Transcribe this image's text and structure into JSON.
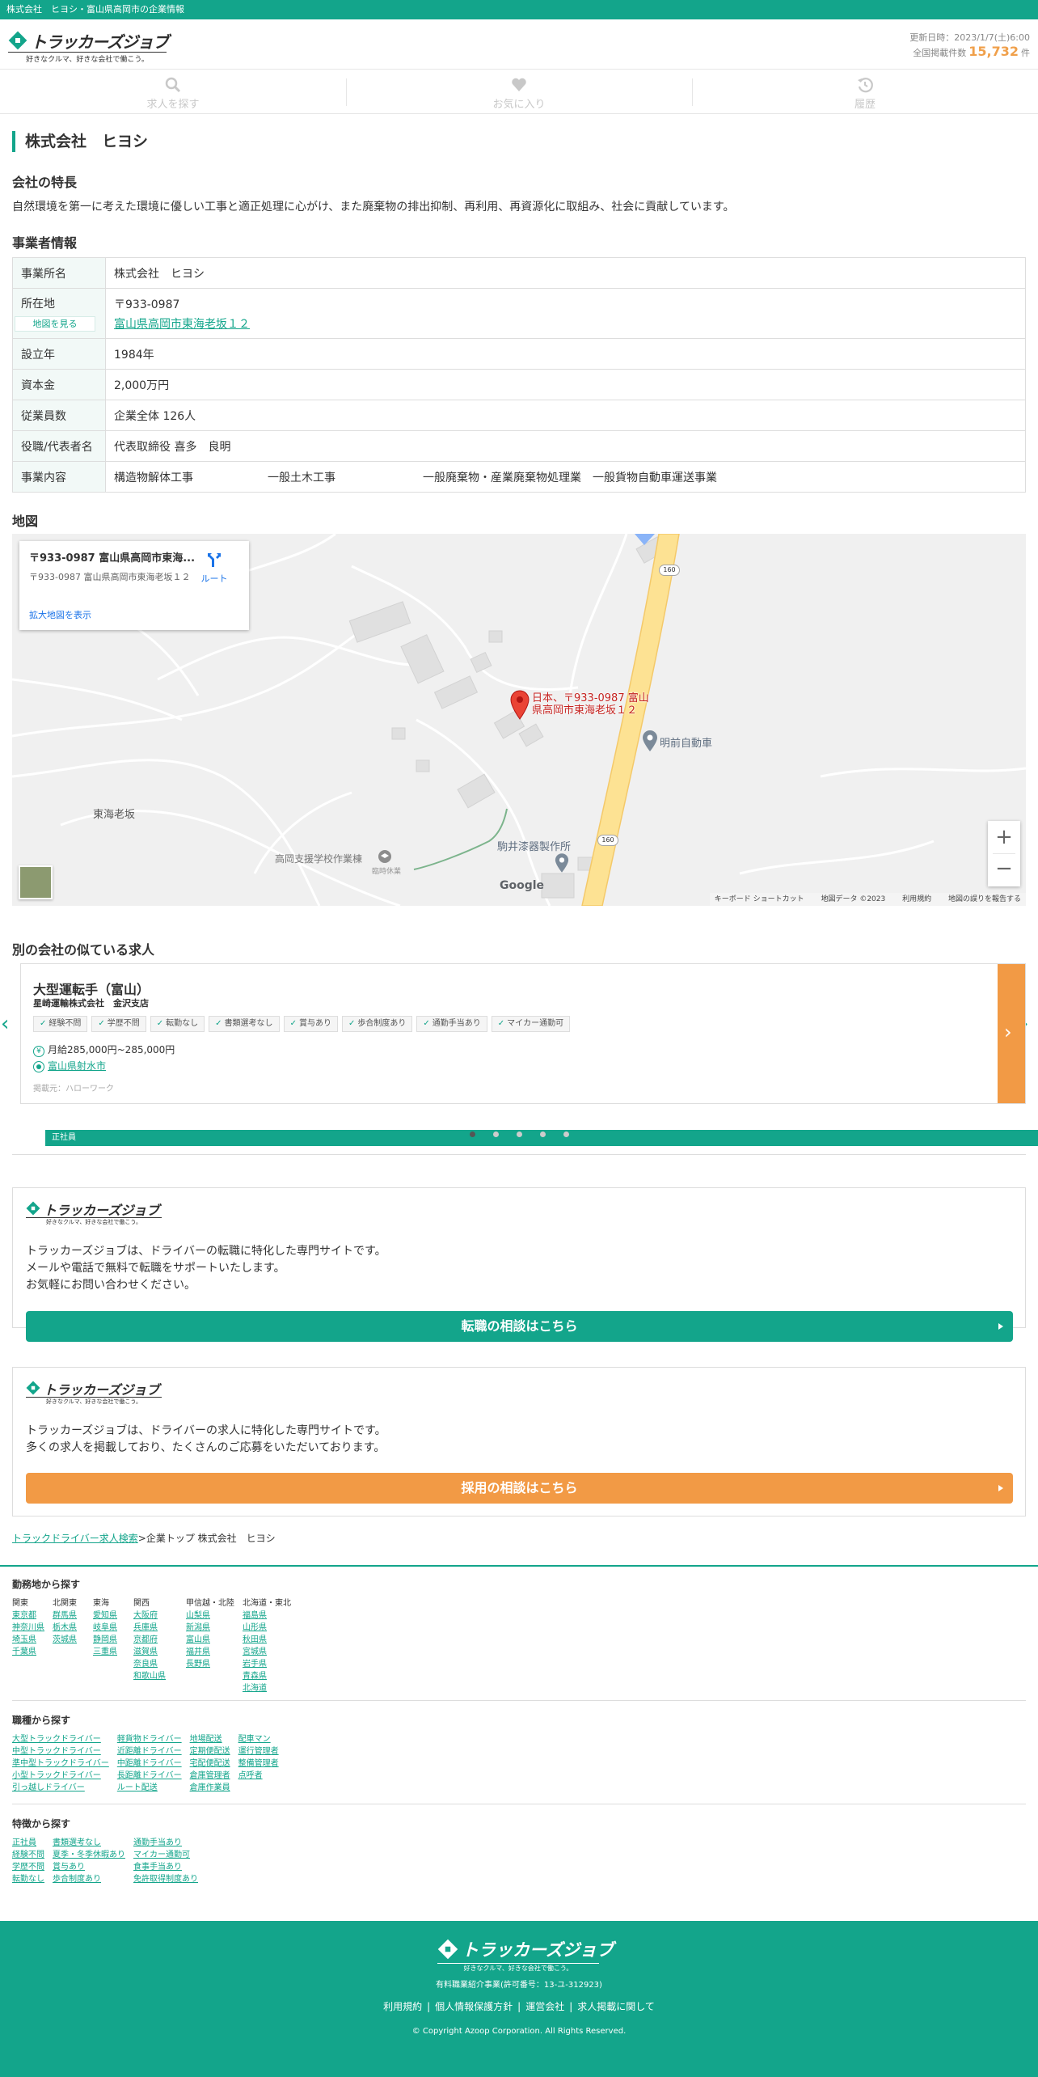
{
  "topbar": {
    "text": "株式会社　ヒヨシ・富山県高岡市の企業情報"
  },
  "brand": {
    "name": "トラッカーズジョブ",
    "tagline": "好きなクルマ、好きな会社で働こう。",
    "accent": "#13a58b",
    "orange": "#f29a45"
  },
  "header": {
    "updated": "更新日時：2023/1/7(土)6:00",
    "count_label": "全国掲載件数",
    "count": "15,732",
    "count_unit": "件"
  },
  "nav": [
    {
      "label": "求人を探す",
      "icon": "search-icon"
    },
    {
      "label": "お気に入り",
      "icon": "heart-icon"
    },
    {
      "label": "履歴",
      "icon": "history-icon"
    }
  ],
  "company": {
    "title": "株式会社　ヒヨシ",
    "feature_heading": "会社の特長",
    "feature_text": "自然環境を第一に考えた環境に優しい工事と適正処理に心がけ、また廃棄物の排出抑制、再利用、再資源化に取組み、社会に貢献しています。",
    "info_heading": "事業者情報",
    "info": {
      "name_k": "事業所名",
      "name_v": "株式会社　ヒヨシ",
      "addr_k": "所在地",
      "map_btn": "地図を見る",
      "zip": "〒933-0987",
      "addr": "富山県高岡市東海老坂１２",
      "est_k": "設立年",
      "est_v": "1984年",
      "cap_k": "資本金",
      "cap_v": "2,000万円",
      "emp_k": "従業員数",
      "emp_v": "企業全体 126人",
      "rep_k": "役職/代表者名",
      "rep_v": "代表取締役 喜多　良明",
      "biz_k": "事業内容",
      "biz_1": "構造物解体工事",
      "biz_2": "一般土木工事",
      "biz_3": "一般廃棄物・産業廃棄物処理業　一般貨物自動車運送事業"
    }
  },
  "map": {
    "heading": "地図",
    "card_title": "〒933-0987 富山県高岡市東海...",
    "card_addr": "〒933-0987 富山県高岡市東海老坂１２",
    "route": "ルート",
    "enlarge": "拡大地図を表示",
    "pin_label": "日本、〒933-0987 富山県高岡市東海老坂１２",
    "poi_1": "明前自動車",
    "poi_2": "東海老坂",
    "poi_3": "高岡支援学校作業棟",
    "poi_3b": "臨時休業",
    "poi_4": "駒井漆器製作所",
    "road": "160",
    "google": "Google",
    "attr_1": "キーボード ショートカット",
    "attr_2": "地図データ ©2023",
    "attr_3": "利用規約",
    "attr_4": "地図の誤りを報告する"
  },
  "similar": {
    "heading": "別の会社の似ている求人",
    "job_title": "大型運転手（富山）",
    "job_company": "星崎運輸株式会社　金沢支店",
    "tags": [
      "正社員",
      "経験不問",
      "学歴不問",
      "転勤なし",
      "書類選考なし",
      "賞与あり",
      "歩合制度あり",
      "通勤手当あり",
      "マイカー通勤可"
    ],
    "salary": "月給285,000円~285,000円",
    "location": "富山県射水市",
    "source": "掲載元：ハローワーク"
  },
  "promo1": {
    "line1": "トラッカーズジョブは、ドライバーの転職に特化した専門サイトです。",
    "line2": "メールや電話で無料で転職をサポートいたします。",
    "line3": "お気軽にお問い合わせください。",
    "button": "転職の相談はこちら"
  },
  "promo2": {
    "line1": "トラッカーズジョブは、ドライバーの求人に特化した専門サイトです。",
    "line2": "多くの求人を掲載しており、たくさんのご応募をいただいております。",
    "button": "採用の相談はこちら"
  },
  "breadcrumb": {
    "link": "トラックドライバー求人検索",
    "rest": ">企業トップ 株式会社　ヒヨシ"
  },
  "area": {
    "heading": "勤務地から探す",
    "cols": [
      {
        "hd": "関東",
        "items": [
          "東京都",
          "神奈川県",
          "埼玉県",
          "千葉県"
        ]
      },
      {
        "hd": "北関東",
        "items": [
          "群馬県",
          "栃木県",
          "茨城県"
        ]
      },
      {
        "hd": "東海",
        "items": [
          "愛知県",
          "岐阜県",
          "静岡県",
          "三重県"
        ]
      },
      {
        "hd": "関西",
        "items": [
          "大阪府",
          "兵庫県",
          "京都府",
          "滋賀県",
          "奈良県",
          "和歌山県"
        ]
      },
      {
        "hd": "甲信越・北陸",
        "items": [
          "山梨県",
          "新潟県",
          "富山県",
          "福井県",
          "長野県"
        ]
      },
      {
        "hd": "北海道・東北",
        "items": [
          "福島県",
          "山形県",
          "秋田県",
          "宮城県",
          "岩手県",
          "青森県",
          "北海道"
        ]
      }
    ]
  },
  "job_type": {
    "heading": "職種から探す",
    "cols": [
      [
        "大型トラックドライバー",
        "中型トラックドライバー",
        "準中型トラックドライバー",
        "小型トラックドライバー",
        "引っ越しドライバー"
      ],
      [
        "軽貨物ドライバー",
        "近距離ドライバー",
        "中距離ドライバー",
        "長距離ドライバー",
        "ルート配送"
      ],
      [
        "地場配送",
        "定期便配送",
        "宅配便配送",
        "倉庫管理者",
        "倉庫作業員"
      ],
      [
        "配車マン",
        "運行管理者",
        "整備管理者",
        "点呼者"
      ]
    ]
  },
  "feature": {
    "heading": "特徴から探す",
    "cols": [
      [
        "正社員",
        "経験不問",
        "学歴不問",
        "転勤なし"
      ],
      [
        "書類選考なし",
        "夏季・冬季休暇あり",
        "賞与あり",
        "歩合制度あり"
      ],
      [
        "通勤手当あり",
        "マイカー通勤可",
        "食事手当あり",
        "免許取得制度あり"
      ]
    ]
  },
  "footer": {
    "license": "有料職業紹介事業(許可番号：13-ユ-312923)",
    "links": [
      "利用規約",
      "個人情報保護方針",
      "運営会社",
      "求人掲載に関して"
    ],
    "copyright": "© Copyright Azoop Corporation. All Rights Reserved."
  }
}
